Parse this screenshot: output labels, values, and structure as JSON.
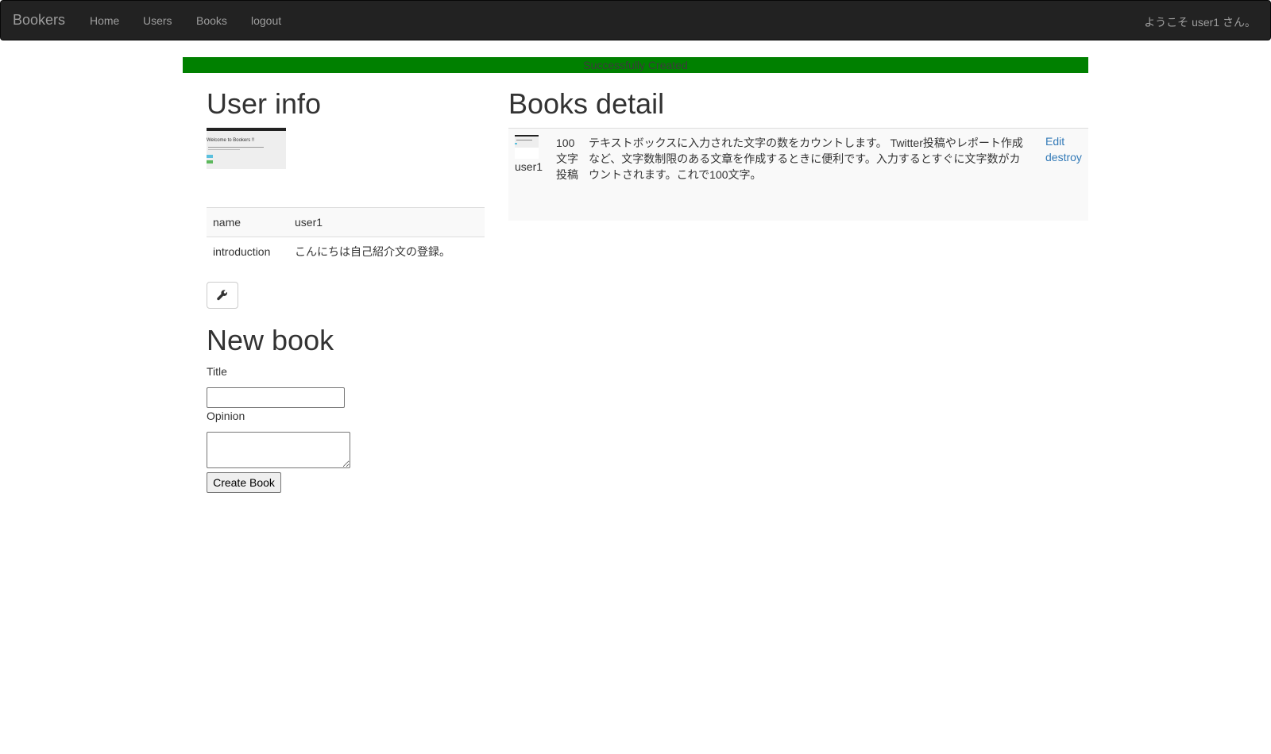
{
  "navbar": {
    "brand": "Bookers",
    "links": [
      "Home",
      "Users",
      "Books",
      "logout"
    ],
    "welcome": "ようこそ user1 さん。"
  },
  "flash": {
    "message": "Successfully Created",
    "color": "#008000"
  },
  "user_info": {
    "heading": "User info",
    "profile_image_text": "Welcome to Bookers !!",
    "rows": [
      {
        "label": "name",
        "value": "user1"
      },
      {
        "label": "introduction",
        "value": "こんにちは自己紹介文の登録。"
      }
    ],
    "edit_icon": "wrench-icon"
  },
  "new_book": {
    "heading": "New book",
    "title_label": "Title",
    "title_value": "",
    "opinion_label": "Opinion",
    "opinion_value": "",
    "submit_label": "Create Book"
  },
  "books_detail": {
    "heading": "Books detail",
    "book": {
      "user": "user1",
      "title": "100文字投稿",
      "body": "テキストボックスに入力された文字の数をカウントします。 Twitter投稿やレポート作成など、文字数制限のある文章を作成するときに便利です。入力するとすぐに文字数がカウントされます。これで100文字。",
      "edit_label": "Edit",
      "destroy_label": "destroy"
    }
  },
  "colors": {
    "navbar_bg": "#222222",
    "nav_text": "#9d9d9d",
    "link": "#337ab7"
  }
}
